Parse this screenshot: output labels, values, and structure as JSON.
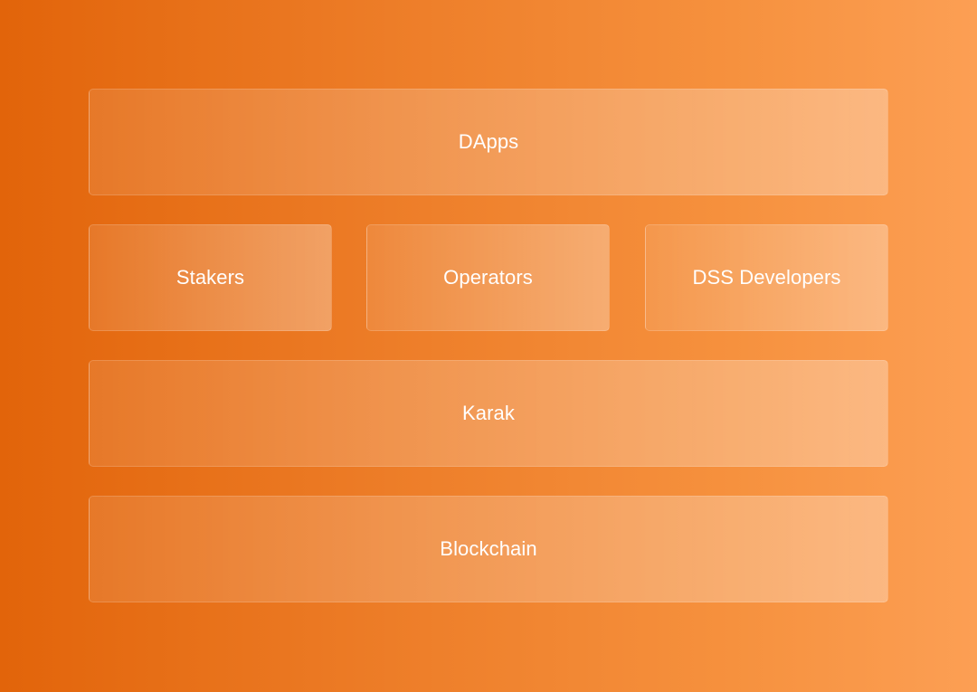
{
  "diagram": {
    "layers": [
      {
        "boxes": [
          {
            "label": "DApps"
          }
        ]
      },
      {
        "boxes": [
          {
            "label": "Stakers"
          },
          {
            "label": "Operators"
          },
          {
            "label": "DSS Developers"
          }
        ]
      },
      {
        "boxes": [
          {
            "label": "Karak"
          }
        ]
      },
      {
        "boxes": [
          {
            "label": "Blockchain"
          }
        ]
      }
    ]
  },
  "colors": {
    "background_start": "#e2640a",
    "background_end": "#fc9f54",
    "text": "#ffffff"
  }
}
